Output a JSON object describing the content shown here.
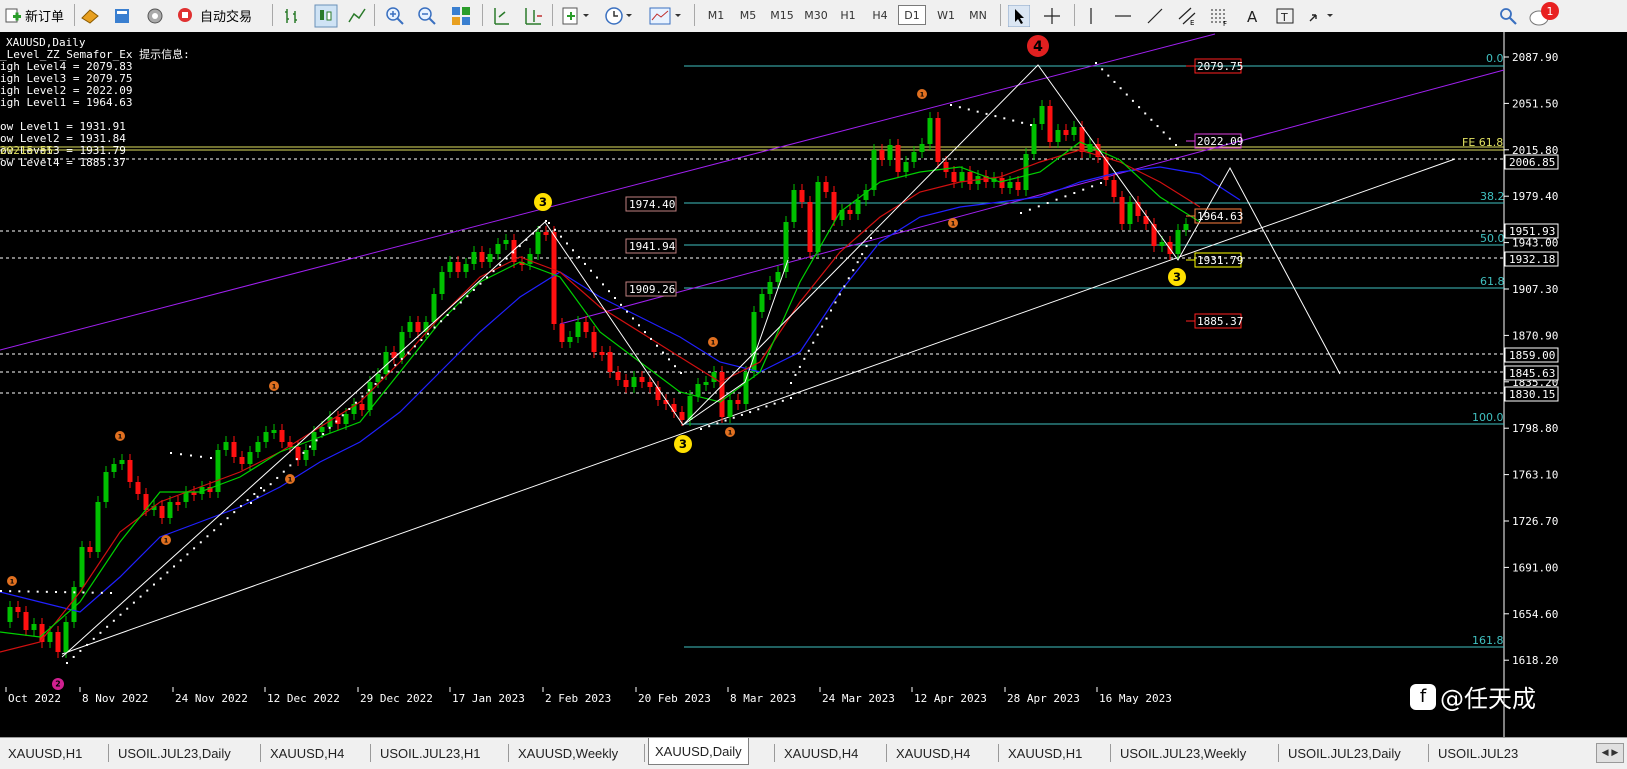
{
  "toolbar": {
    "new_order": "新订单",
    "auto_trading": "自动交易",
    "timeframes": [
      "M1",
      "M5",
      "M15",
      "M30",
      "H1",
      "H4",
      "D1",
      "W1",
      "MN"
    ],
    "active_timeframe": "D1",
    "notification_count": "1"
  },
  "chart": {
    "symbol_label": "XAUUSD,Daily",
    "indicator_title": "_Level_ZZ_Semafor_Ex 提示信息:",
    "info_lines": [
      "igh Level4 = 2079.83",
      "igh Level3 = 2079.75",
      "igh Level2 = 2022.09",
      "igh Level1 = 1964.63",
      "ow Level1 = 1931.91",
      "ow Level2 = 1931.84",
      "ow Level3 = 1931.79",
      "ow Level4 = 1885.37"
    ],
    "overlap_text": "20215.55",
    "price_axis": [
      "2087.90",
      "2051.50",
      "2015.80",
      "1979.40",
      "1943.00",
      "1907.30",
      "1870.90",
      "1835.20",
      "1798.80",
      "1763.10",
      "1726.70",
      "1691.00",
      "1654.60",
      "1618.20"
    ],
    "price_tags": [
      {
        "text": "2006.85",
        "color": "#ffffff"
      },
      {
        "text": "1951.93",
        "color": "#ffffff"
      },
      {
        "text": "1932.18",
        "color": "#ffffff"
      },
      {
        "text": "1859.00",
        "color": "#ffffff"
      },
      {
        "text": "1845.63",
        "color": "#ffffff"
      },
      {
        "text": "1830.15",
        "color": "#ffffff"
      }
    ],
    "date_axis": [
      "Oct 2022",
      "8 Nov 2022",
      "24 Nov 2022",
      "12 Dec 2022",
      "29 Dec 2022",
      "17 Jan 2023",
      "2 Feb 2023",
      "20 Feb 2023",
      "8 Mar 2023",
      "24 Mar 2023",
      "12 Apr 2023",
      "28 Apr 2023",
      "16 May 2023"
    ],
    "fib_levels": [
      "0.0",
      "FE 61.8",
      "38.2",
      "50.0",
      "61.8",
      "100.0",
      "161.8"
    ],
    "level_boxes": [
      {
        "text": "1974.40",
        "color": "#ffffff"
      },
      {
        "text": "1941.94",
        "color": "#ffffff"
      },
      {
        "text": "1909.26",
        "color": "#ffffff"
      }
    ],
    "semafor_labels": [
      {
        "text": "2079.75",
        "color": "#ff2020"
      },
      {
        "text": "2022.09",
        "color": "#e040e0"
      },
      {
        "text": "1964.63",
        "color": "#ff8040"
      },
      {
        "text": "1931.79",
        "color": "#ffff00"
      },
      {
        "text": "1885.37",
        "color": "#ff2020"
      }
    ],
    "semafor_markers": [
      "1",
      "2",
      "3",
      "4"
    ],
    "watermark": "@任天成",
    "colors": {
      "bull": "#00c000",
      "bear": "#ff1010",
      "ma_fast": "#00d000",
      "ma_mid": "#d01010",
      "ma_slow": "#2020ff",
      "channel": "#a020f0",
      "fib": "#40c0c0",
      "hline_yellow": "#e0e060"
    }
  },
  "tabs": [
    {
      "label": "XAUUSD,H1",
      "active": false
    },
    {
      "label": "USOIL.JUL23,Daily",
      "active": false
    },
    {
      "label": "XAUUSD,H4",
      "active": false
    },
    {
      "label": "USOIL.JUL23,H1",
      "active": false
    },
    {
      "label": "XAUUSD,Weekly",
      "active": false
    },
    {
      "label": "XAUUSD,Daily",
      "active": true
    },
    {
      "label": "XAUUSD,H4",
      "active": false
    },
    {
      "label": "XAUUSD,H4",
      "active": false
    },
    {
      "label": "XAUUSD,H1",
      "active": false
    },
    {
      "label": "USOIL.JUL23,Weekly",
      "active": false
    },
    {
      "label": "USOIL.JUL23,Daily",
      "active": false
    },
    {
      "label": "USOIL.JUL23",
      "active": false
    }
  ]
}
